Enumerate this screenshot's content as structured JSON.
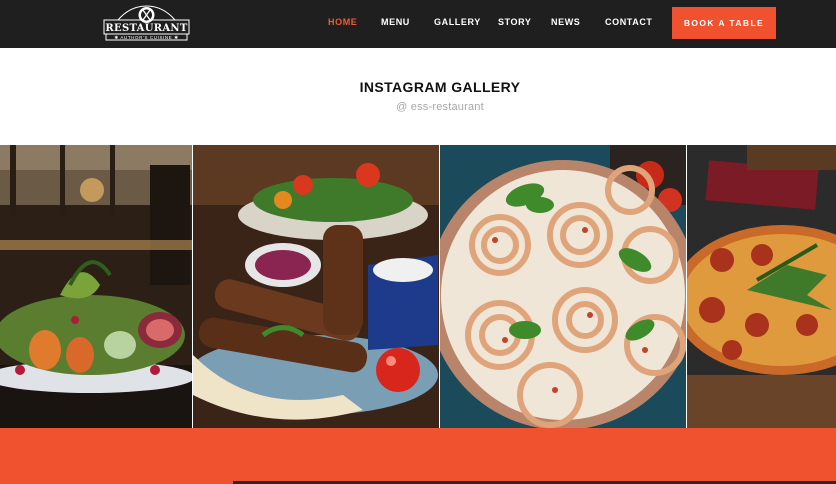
{
  "header": {
    "logo": {
      "name": "RESTAURANT",
      "tagline": "✱ AUTHOR'S CUISINE ✱",
      "icon": "fork-knife-plate-icon"
    },
    "nav": [
      {
        "label": "HOME",
        "active": true
      },
      {
        "label": "MENU",
        "active": false
      },
      {
        "label": "GALLERY",
        "active": false
      },
      {
        "label": "STORY",
        "active": false
      },
      {
        "label": "NEWS",
        "active": false
      },
      {
        "label": "CONTACT",
        "active": false
      }
    ],
    "cta_label": "BOOK A TABLE"
  },
  "gallery": {
    "title": "INSTAGRAM GALLERY",
    "handle": "@ ess-restaurant",
    "photos": [
      {
        "subject": "roasted vegetable salad with figs and pomegranate"
      },
      {
        "subject": "grilled kebabs with flatbread, onions and tomatoes"
      },
      {
        "subject": "tagliatelle nests with tomato sauce and basil"
      },
      {
        "subject": "pepperoni pizza with arugula"
      }
    ]
  },
  "colors": {
    "header_bg": "#1f1f1f",
    "accent": "#f0512e",
    "active_nav": "#f25a33",
    "title": "#111111",
    "handle": "#a7a7a7"
  }
}
